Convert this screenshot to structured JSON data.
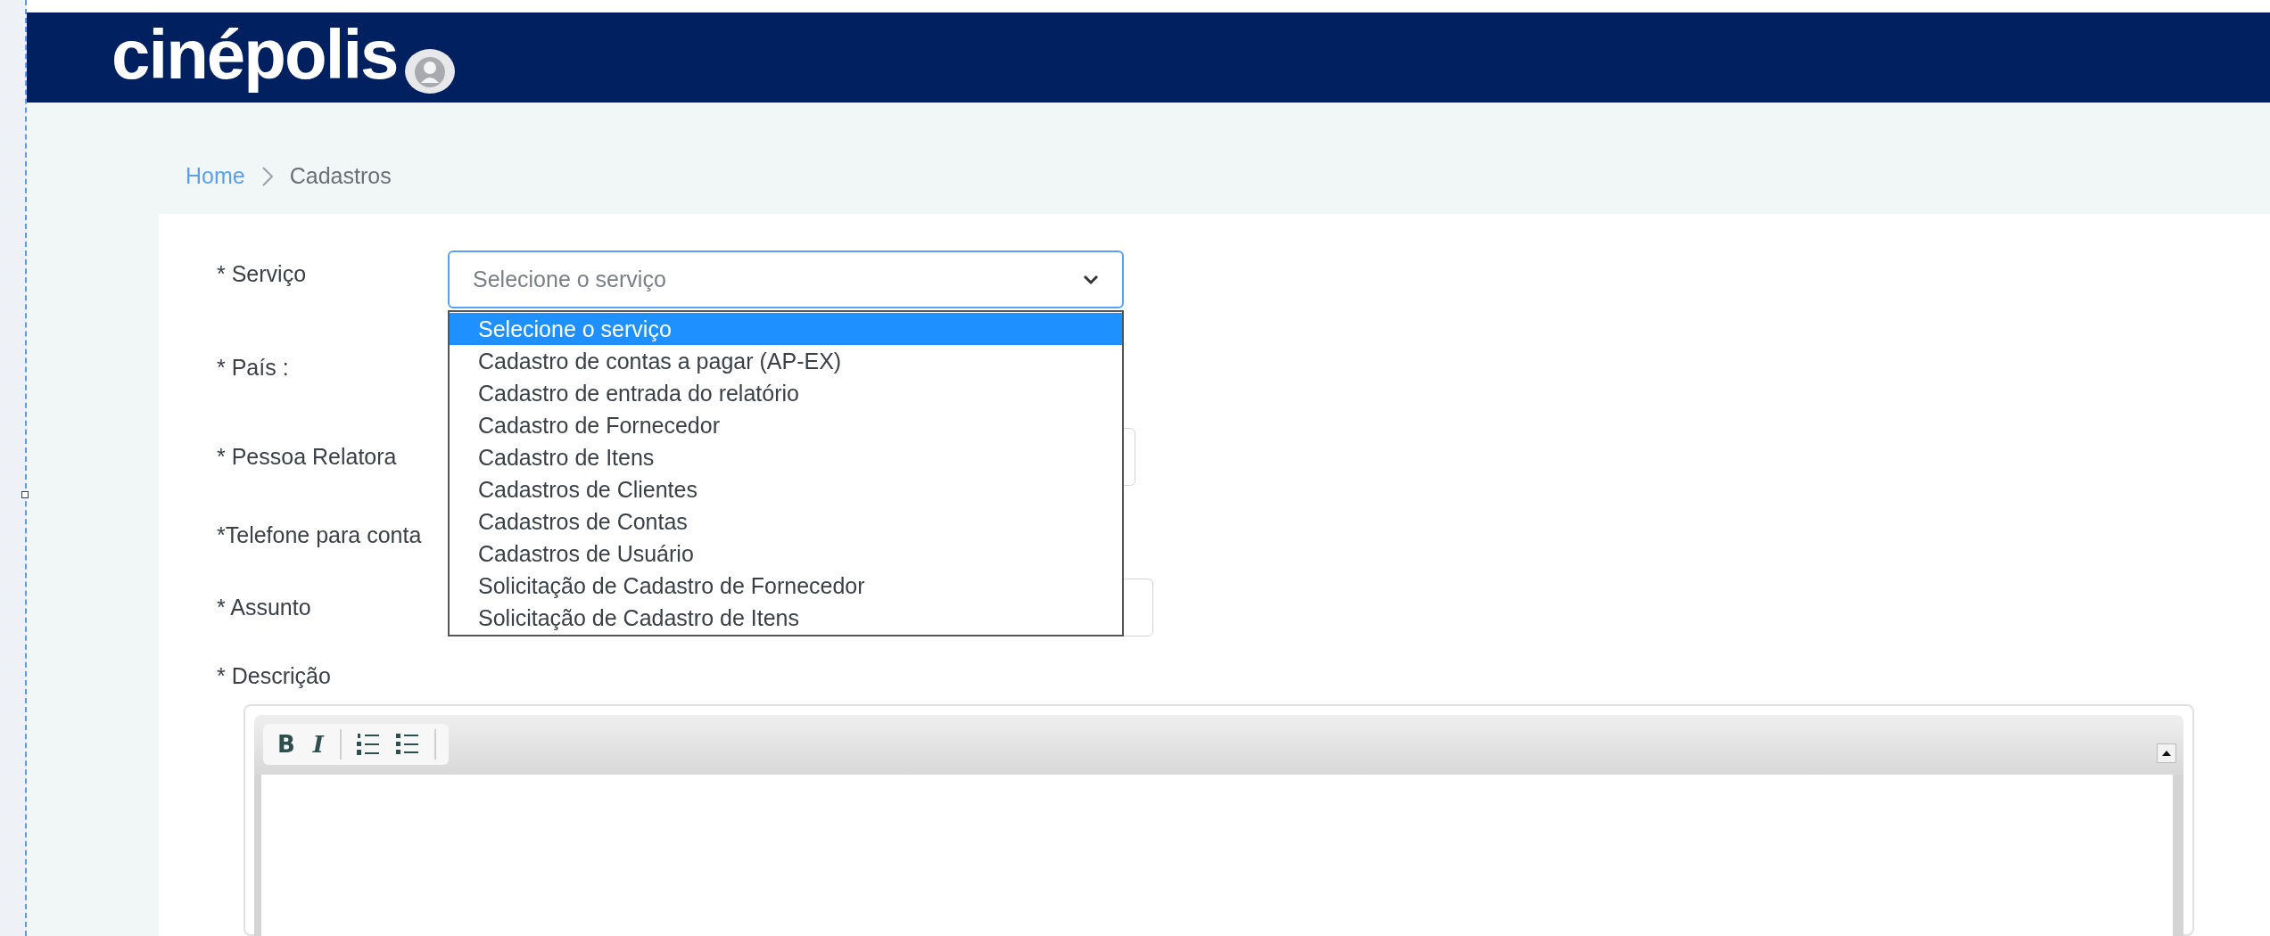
{
  "header": {
    "logo": "cinépolis"
  },
  "breadcrumb": [
    {
      "label": "Home",
      "link": true
    },
    {
      "label": "Cadastros",
      "link": false
    }
  ],
  "service": {
    "label": "* Serviço",
    "placeholder": "Selecione o serviço",
    "open": true,
    "options": [
      {
        "label": "Selecione o serviço",
        "selected": true
      },
      {
        "label": "Cadastro de contas a pagar (AP-EX)",
        "selected": false
      },
      {
        "label": "Cadastro de entrada do relatório",
        "selected": false
      },
      {
        "label": "Cadastro de Fornecedor",
        "selected": false
      },
      {
        "label": "Cadastro de Itens",
        "selected": false
      },
      {
        "label": "Cadastros de Clientes",
        "selected": false
      },
      {
        "label": "Cadastros de Contas",
        "selected": false
      },
      {
        "label": "Cadastros de Usuário",
        "selected": false
      },
      {
        "label": "Solicitação de Cadastro de Fornecedor",
        "selected": false
      },
      {
        "label": "Solicitação de Cadastro de Itens",
        "selected": false
      }
    ]
  },
  "fields": [
    {
      "label": "* País :",
      "kind": "covered"
    },
    {
      "label": "* Pessoa Relatora",
      "kind": "input"
    },
    {
      "label": "*Telefone para conta",
      "kind": "covered"
    },
    {
      "label": "* Assunto",
      "kind": "input"
    }
  ],
  "description": {
    "label": "* Descrição",
    "toolbar": [
      {
        "kind": "bold",
        "label": "B"
      },
      {
        "kind": "italic",
        "label": "I"
      },
      {
        "kind": "separator"
      },
      {
        "kind": "ordered-list"
      },
      {
        "kind": "bullet-list"
      },
      {
        "kind": "separator"
      }
    ]
  }
}
